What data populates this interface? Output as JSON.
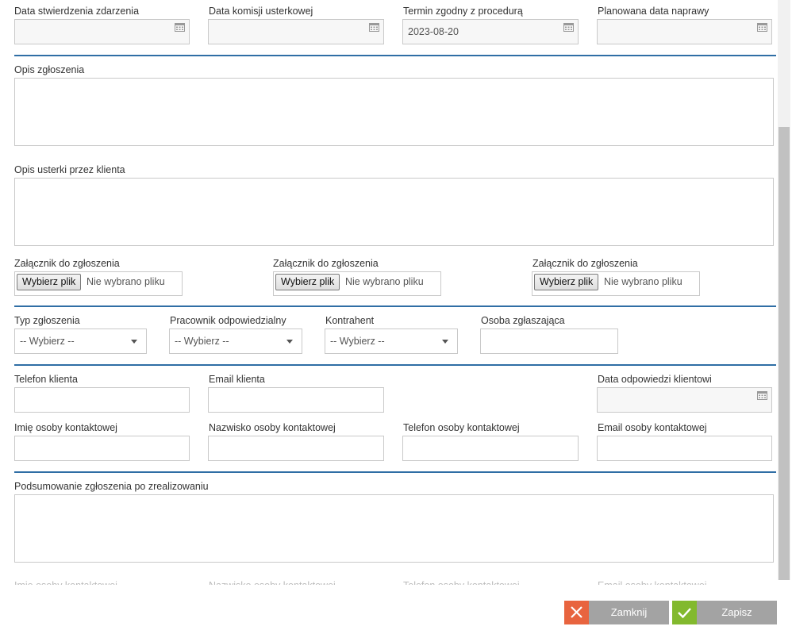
{
  "dates": {
    "stwierdzenie": {
      "label": "Data stwierdzenia zdarzenia",
      "value": ""
    },
    "komisja": {
      "label": "Data komisji usterkowej",
      "value": ""
    },
    "termin": {
      "label": "Termin zgodny z procedurą",
      "value": "2023-08-20"
    },
    "planowana": {
      "label": "Planowana data naprawy",
      "value": ""
    }
  },
  "opis_zgloszenia": {
    "label": "Opis zgłoszenia",
    "value": ""
  },
  "opis_usterki": {
    "label": "Opis usterki przez klienta",
    "value": ""
  },
  "attachments": [
    {
      "label": "Załącznik do zgłoszenia",
      "button": "Wybierz plik",
      "status": "Nie wybrano pliku"
    },
    {
      "label": "Załącznik do zgłoszenia",
      "button": "Wybierz plik",
      "status": "Nie wybrano pliku"
    },
    {
      "label": "Załącznik do zgłoszenia",
      "button": "Wybierz plik",
      "status": "Nie wybrano pliku"
    }
  ],
  "typ": {
    "label": "Typ zgłoszenia",
    "value": "-- Wybierz --"
  },
  "pracownik": {
    "label": "Pracownik odpowiedzialny",
    "value": "-- Wybierz --"
  },
  "kontrahent": {
    "label": "Kontrahent",
    "value": "-- Wybierz --"
  },
  "osoba": {
    "label": "Osoba zgłaszająca",
    "value": ""
  },
  "telefon_klienta": {
    "label": "Telefon klienta",
    "value": ""
  },
  "email_klienta": {
    "label": "Email klienta",
    "value": ""
  },
  "data_odpowiedzi": {
    "label": "Data odpowiedzi klientowi",
    "value": ""
  },
  "imie_kontakt": {
    "label": "Imię osoby kontaktowej",
    "value": ""
  },
  "nazwisko_kontakt": {
    "label": "Nazwisko osoby kontaktowej",
    "value": ""
  },
  "telefon_kontakt": {
    "label": "Telefon osoby kontaktowej",
    "value": ""
  },
  "email_kontakt": {
    "label": "Email osoby kontaktowej",
    "value": ""
  },
  "podsumowanie": {
    "label": "Podsumowanie zgłoszenia po zrealizowaniu",
    "value": ""
  },
  "faded_labels": [
    "Imię osoby kontaktowej",
    "Nazwisko osoby kontaktowej",
    "Telefon osoby kontaktowej",
    "Email osoby kontaktowej"
  ],
  "actions": {
    "close": "Zamknij",
    "save": "Zapisz"
  },
  "colors": {
    "accent": "#2f6ea5",
    "close_icon_bg": "#e8643f",
    "save_icon_bg": "#82b92e",
    "button_bg": "#a3a3a3"
  }
}
